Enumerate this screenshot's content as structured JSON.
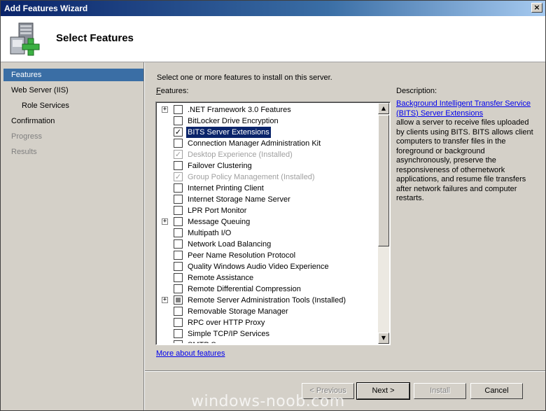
{
  "window": {
    "title": "Add Features Wizard",
    "close_glyph": "×"
  },
  "header": {
    "title": "Select Features"
  },
  "nav": {
    "items": [
      {
        "label": "Features",
        "state": "active",
        "level": 0
      },
      {
        "label": "Web Server (IIS)",
        "state": "normal",
        "level": 0
      },
      {
        "label": "Role Services",
        "state": "normal",
        "level": 1
      },
      {
        "label": "Confirmation",
        "state": "normal",
        "level": 0
      },
      {
        "label": "Progress",
        "state": "disabled",
        "level": 0
      },
      {
        "label": "Results",
        "state": "disabled",
        "level": 0
      }
    ]
  },
  "main": {
    "intro": "Select one or more features to install on this server.",
    "features_label_accel": "F",
    "features_label_rest": "eatures:",
    "features": [
      {
        "label": ".NET Framework 3.0 Features",
        "expandable": true,
        "checked": false,
        "dim": false
      },
      {
        "label": "BitLocker Drive Encryption",
        "expandable": false,
        "checked": false,
        "dim": false
      },
      {
        "label": "BITS Server Extensions",
        "expandable": false,
        "checked": true,
        "dim": false,
        "selected": true
      },
      {
        "label": "Connection Manager Administration Kit",
        "expandable": false,
        "checked": false,
        "dim": false
      },
      {
        "label": "Desktop Experience  (Installed)",
        "expandable": false,
        "checked": true,
        "dim": true
      },
      {
        "label": "Failover Clustering",
        "expandable": false,
        "checked": false,
        "dim": false
      },
      {
        "label": "Group Policy Management  (Installed)",
        "expandable": false,
        "checked": true,
        "dim": true
      },
      {
        "label": "Internet Printing Client",
        "expandable": false,
        "checked": false,
        "dim": false
      },
      {
        "label": "Internet Storage Name Server",
        "expandable": false,
        "checked": false,
        "dim": false
      },
      {
        "label": "LPR Port Monitor",
        "expandable": false,
        "checked": false,
        "dim": false
      },
      {
        "label": "Message Queuing",
        "expandable": true,
        "checked": false,
        "dim": false
      },
      {
        "label": "Multipath I/O",
        "expandable": false,
        "checked": false,
        "dim": false
      },
      {
        "label": "Network Load Balancing",
        "expandable": false,
        "checked": false,
        "dim": false
      },
      {
        "label": "Peer Name Resolution Protocol",
        "expandable": false,
        "checked": false,
        "dim": false
      },
      {
        "label": "Quality Windows Audio Video Experience",
        "expandable": false,
        "checked": false,
        "dim": false
      },
      {
        "label": "Remote Assistance",
        "expandable": false,
        "checked": false,
        "dim": false
      },
      {
        "label": "Remote Differential Compression",
        "expandable": false,
        "checked": false,
        "dim": false
      },
      {
        "label": "Remote Server Administration Tools  (Installed)",
        "expandable": true,
        "checked": "partial",
        "dim": false
      },
      {
        "label": "Removable Storage Manager",
        "expandable": false,
        "checked": false,
        "dim": false
      },
      {
        "label": "RPC over HTTP Proxy",
        "expandable": false,
        "checked": false,
        "dim": false
      },
      {
        "label": "Simple TCP/IP Services",
        "expandable": false,
        "checked": false,
        "dim": false
      },
      {
        "label": "SMTP Server",
        "expandable": false,
        "checked": false,
        "dim": false
      }
    ],
    "more_link": "More about features"
  },
  "description": {
    "label": "Description:",
    "link": "Background Intelligent Transfer Service (BITS) Server Extensions",
    "text": "allow a server to receive files uploaded by clients using BITS. BITS allows client computers to transfer files in the foreground or background asynchronously, preserve the responsiveness of othernetwork applications, and resume file transfers after network failures and computer restarts."
  },
  "buttons": {
    "previous": "< Previous",
    "next": "Next >",
    "install": "Install",
    "cancel": "Cancel"
  },
  "icons": {
    "expand": "+",
    "check": "✓",
    "scroll_up": "▲",
    "scroll_down": "▼"
  },
  "watermark": "windows-noob.com",
  "colors": {
    "nav_active": "#3a6ea5",
    "selection": "#0a246a",
    "link": "#0000ee"
  }
}
